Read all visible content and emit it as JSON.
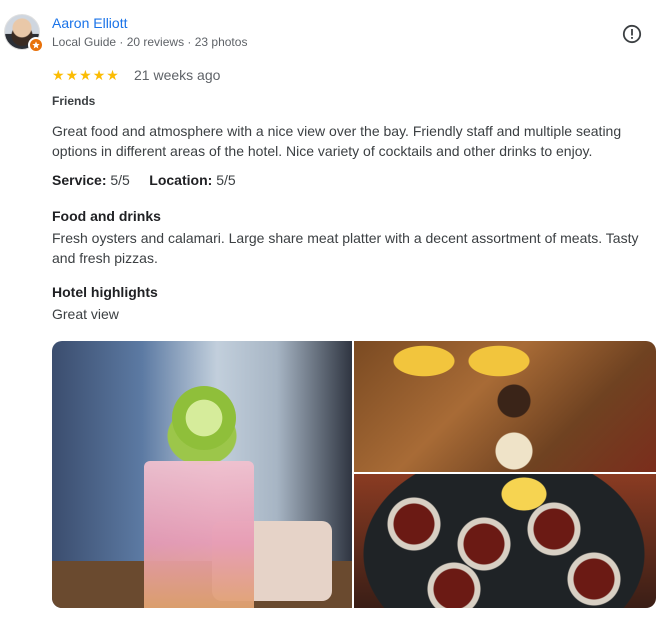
{
  "reviewer": {
    "name": "Aaron Elliott",
    "meta": "Local Guide · 20 reviews · 23 photos"
  },
  "review": {
    "rating": 5,
    "stars": [
      "★",
      "★",
      "★",
      "★",
      "★"
    ],
    "time": "21 weeks ago",
    "tag": "Friends",
    "text": "Great food and atmosphere with a nice view over the bay. Friendly staff and multiple seating options in different areas of the hotel. Nice variety of cocktails and other drinks to enjoy.",
    "ratings": {
      "service_label": "Service:",
      "service_value": "5/5",
      "location_label": "Location:",
      "location_value": "5/5"
    },
    "sections": [
      {
        "heading": "Food and drinks",
        "text": "Fresh oysters and calamari. Large share meat platter with a decent assortment of meats. Tasty and fresh pizzas."
      },
      {
        "heading": "Hotel highlights",
        "text": "Great view"
      }
    ]
  },
  "colors": {
    "link": "#1a73e8",
    "star": "#fbbc04",
    "local_guide_badge": "#e8710a"
  },
  "icons": {
    "report": "report-icon",
    "badge": "local-guide-badge-icon"
  }
}
